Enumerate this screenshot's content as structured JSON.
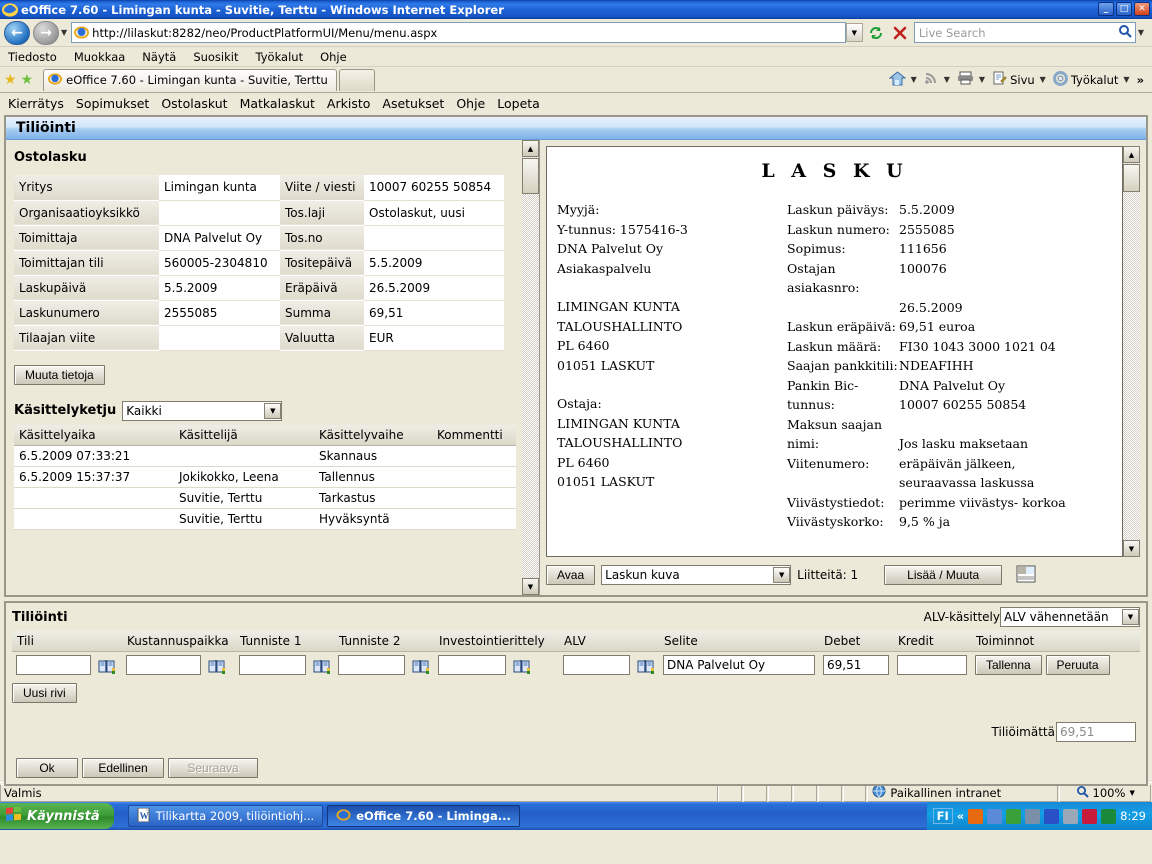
{
  "window": {
    "title": "eOffice 7.60 - Limingan kunta - Suvitie, Terttu - Windows Internet Explorer",
    "minimize": "_",
    "maximize": "□",
    "close": "✕"
  },
  "browser": {
    "url": "http://lilaskut:8282/neo/ProductPlatformUI/Menu/menu.aspx",
    "search_placeholder": "Live Search",
    "menu": [
      "Tiedosto",
      "Muokkaa",
      "Näytä",
      "Suosikit",
      "Työkalut",
      "Ohje"
    ],
    "tab_label": "eOffice 7.60 - Limingan kunta - Suvitie, Terttu",
    "toolbar_right": [
      "Sivu",
      "Työkalut"
    ],
    "overflow": "»"
  },
  "app_menu": [
    "Kierrätys",
    "Sopimukset",
    "Ostolaskut",
    "Matkalaskut",
    "Arkisto",
    "Asetukset",
    "Ohje",
    "Lopeta"
  ],
  "panel": {
    "title": "Tiliöinti",
    "invoice_section_title": "Ostolasku",
    "fields": [
      {
        "label": "Yritys",
        "value": "Limingan kunta",
        "label2": "Viite / viesti",
        "value2": "10007 60255 50854"
      },
      {
        "label": "Organisaatioyksikkö",
        "value": "",
        "label2": "Tos.laji",
        "value2": "Ostolaskut, uusi"
      },
      {
        "label": "Toimittaja",
        "value": "DNA Palvelut Oy",
        "label2": "Tos.no",
        "value2": ""
      },
      {
        "label": "Toimittajan tili",
        "value": "560005-2304810",
        "label2": "Tositepäivä",
        "value2": "5.5.2009"
      },
      {
        "label": "Laskupäivä",
        "value": "5.5.2009",
        "label2": "Eräpäivä",
        "value2": "26.5.2009"
      },
      {
        "label": "Laskunumero",
        "value": "2555085",
        "label2": "Summa",
        "value2": "69,51"
      },
      {
        "label": "Tilaajan viite",
        "value": "",
        "label2": "Valuutta",
        "value2": "EUR"
      }
    ],
    "edit_button": "Muuta tietoja",
    "chain_title": "Käsittelyketju",
    "chain_filter_value": "Kaikki",
    "chain_headers": [
      "Käsittelyaika",
      "Käsittelijä",
      "Käsittelyvaihe",
      "Kommentti"
    ],
    "chain_rows": [
      {
        "time": "6.5.2009 07:33:21",
        "handler": "",
        "stage": "Skannaus",
        "comment": ""
      },
      {
        "time": "6.5.2009 15:37:37",
        "handler": "Jokikokko, Leena",
        "stage": "Tallennus",
        "comment": ""
      },
      {
        "time": "",
        "handler": "Suvitie, Terttu",
        "stage": "Tarkastus",
        "comment": ""
      },
      {
        "time": "",
        "handler": "Suvitie, Terttu",
        "stage": "Hyväksyntä",
        "comment": ""
      }
    ]
  },
  "document": {
    "heading": "L A S K U",
    "left_lines": [
      "Myyjä:",
      "Y-tunnus: 1575416-3",
      "DNA Palvelut Oy",
      "Asiakaspalvelu",
      "",
      "LIMINGAN KUNTA",
      "TALOUSHALLINTO",
      "PL 6460",
      "01051 LASKUT",
      "",
      "Ostaja:",
      "LIMINGAN KUNTA",
      "TALOUSHALLINTO",
      "PL 6460",
      "01051 LASKUT"
    ],
    "right_rows": [
      {
        "key": "Laskun päiväys:",
        "value": "5.5.2009"
      },
      {
        "key": "Laskun numero:",
        "value": "2555085"
      },
      {
        "key": "Sopimus:",
        "value": "111656"
      },
      {
        "key": "Ostajan",
        "value": "100076"
      },
      {
        "key": "asiakasnro:",
        "value": ""
      },
      {
        "key": "",
        "value": "26.5.2009"
      },
      {
        "key": "Laskun eräpäivä:",
        "value": "69,51 euroa"
      },
      {
        "key": "Laskun määrä:",
        "value": "FI30 1043 3000 1021 04"
      },
      {
        "key": "Saajan pankkitili:",
        "value": "NDEAFIHH"
      },
      {
        "key": "Pankin Bic-",
        "value": "DNA Palvelut Oy"
      },
      {
        "key": "tunnus:",
        "value": "10007 60255 50854"
      },
      {
        "key": "Maksun saajan",
        "value": ""
      },
      {
        "key": "nimi:",
        "value": "Jos lasku maksetaan"
      },
      {
        "key": "Viitenumero:",
        "value": "eräpäivän jälkeen,"
      },
      {
        "key": "",
        "value": "seuraavassa laskussa"
      },
      {
        "key": "Viivästystiedot:",
        "value": "perimme viivästys- korkoa"
      },
      {
        "key": "Viivästyskorko:",
        "value": "9,5 % ja"
      }
    ],
    "toolbar": {
      "open_button": "Avaa",
      "view_select_value": "Laskun kuva",
      "attachments_label": "Liitteitä: 1",
      "add_modify_button": "Lisää / Muuta"
    }
  },
  "accounting": {
    "title": "Tiliöinti",
    "vat_label": "ALV-käsittely",
    "vat_value": "ALV vähennetään",
    "headers": [
      "Tili",
      "Kustannuspaikka",
      "Tunniste 1",
      "Tunniste 2",
      "Investointierittely",
      "ALV",
      "Selite",
      "Debet",
      "Kredit",
      "Toiminnot"
    ],
    "row": {
      "tili": "",
      "kustannuspaikka": "",
      "tunniste1": "",
      "tunniste2": "",
      "investointierittely": "",
      "alv": "",
      "selite": "DNA Palvelut Oy",
      "debet": "69,51",
      "kredit": "",
      "save_button": "Tallenna",
      "cancel_button": "Peruuta"
    },
    "new_row_button": "Uusi rivi",
    "unaccounted_label": "Tiliöimättä",
    "unaccounted_value": "69,51"
  },
  "footer": {
    "ok": "Ok",
    "previous": "Edellinen",
    "next": "Seuraava"
  },
  "statusbar": {
    "text": "Valmis",
    "zone": "Paikallinen intranet",
    "zoom": "100%"
  },
  "taskbar": {
    "start": "Käynnistä",
    "items": [
      "Tilikartta 2009, tiliöintiohj...",
      "eOffice 7.60 - Liminga..."
    ],
    "language": "FI",
    "clock": "8:29"
  }
}
